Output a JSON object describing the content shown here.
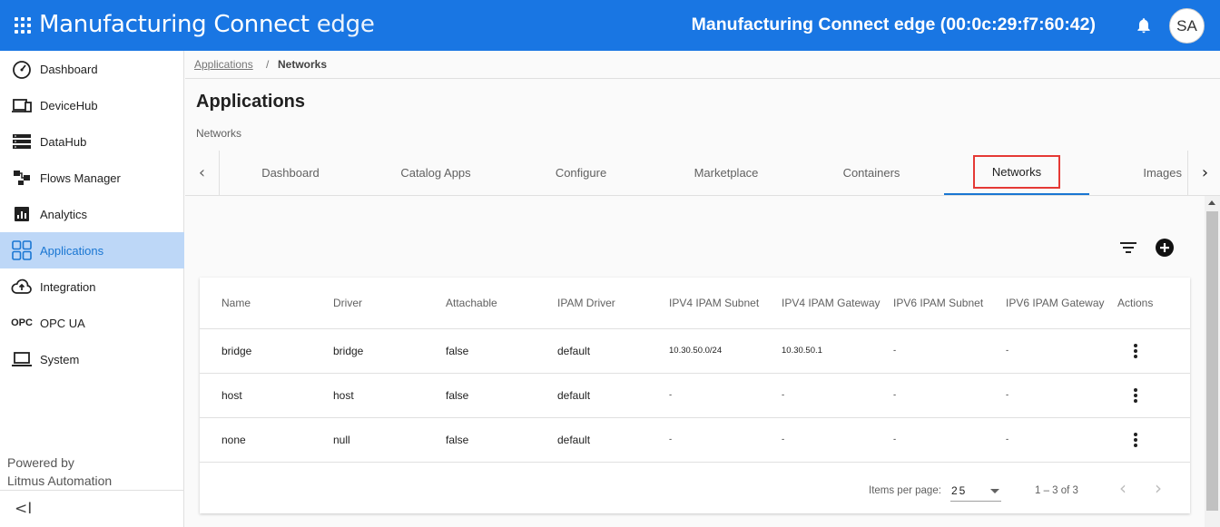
{
  "header": {
    "brand_main": "Manufacturing Connect",
    "brand_suffix": "edge",
    "device_title": "Manufacturing Connect edge (00:0c:29:f7:60:42)",
    "avatar_initials": "SA",
    "accent_color": "#1976e3"
  },
  "sidebar": {
    "items": [
      {
        "label": "Dashboard",
        "icon": "speedometer-icon"
      },
      {
        "label": "DeviceHub",
        "icon": "devices-icon"
      },
      {
        "label": "DataHub",
        "icon": "storage-icon"
      },
      {
        "label": "Flows Manager",
        "icon": "flow-icon"
      },
      {
        "label": "Analytics",
        "icon": "analytics-icon"
      },
      {
        "label": "Applications",
        "icon": "apps-grid-icon",
        "active": true
      },
      {
        "label": "Integration",
        "icon": "cloud-upload-icon"
      },
      {
        "label": "OPC UA",
        "icon": "opc-icon",
        "icon_text": "OPC"
      },
      {
        "label": "System",
        "icon": "laptop-icon"
      }
    ],
    "powered_by_line1": "Powered by",
    "powered_by_line2": "Litmus Automation",
    "collapse_glyph": "<I"
  },
  "breadcrumb": {
    "link": "Applications",
    "separator": "/",
    "current": "Networks"
  },
  "page": {
    "title": "Applications",
    "subtitle": "Networks"
  },
  "tabs": [
    {
      "label": "Dashboard"
    },
    {
      "label": "Catalog Apps"
    },
    {
      "label": "Configure"
    },
    {
      "label": "Marketplace"
    },
    {
      "label": "Containers"
    },
    {
      "label": "Networks",
      "active": true
    },
    {
      "label": "Images"
    }
  ],
  "table": {
    "columns": [
      "Name",
      "Driver",
      "Attachable",
      "IPAM Driver",
      "IPV4 IPAM Subnet",
      "IPV4 IPAM Gateway",
      "IPV6 IPAM Subnet",
      "IPV6 IPAM Gateway",
      "Actions"
    ],
    "rows": [
      [
        "bridge",
        "bridge",
        "false",
        "default",
        "10.30.50.0/24",
        "10.30.50.1",
        "-",
        "-"
      ],
      [
        "host",
        "host",
        "false",
        "default",
        "-",
        "-",
        "-",
        "-"
      ],
      [
        "none",
        "null",
        "false",
        "default",
        "-",
        "-",
        "-",
        "-"
      ]
    ]
  },
  "pagination": {
    "items_per_page_label": "Items per page:",
    "items_per_page_value": "25",
    "range_label": "1 – 3 of 3"
  }
}
